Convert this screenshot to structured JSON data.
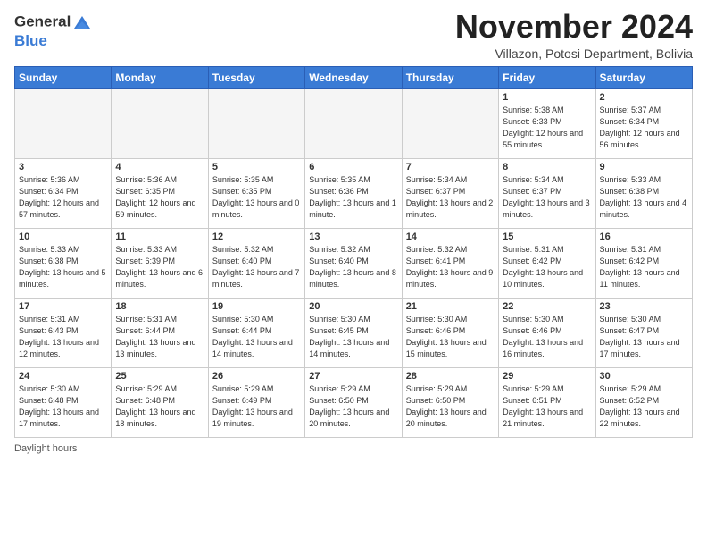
{
  "header": {
    "logo_line1": "General",
    "logo_line2": "Blue",
    "month_title": "November 2024",
    "subtitle": "Villazon, Potosi Department, Bolivia"
  },
  "days_of_week": [
    "Sunday",
    "Monday",
    "Tuesday",
    "Wednesday",
    "Thursday",
    "Friday",
    "Saturday"
  ],
  "weeks": [
    [
      {
        "day": "",
        "info": ""
      },
      {
        "day": "",
        "info": ""
      },
      {
        "day": "",
        "info": ""
      },
      {
        "day": "",
        "info": ""
      },
      {
        "day": "",
        "info": ""
      },
      {
        "day": "1",
        "info": "Sunrise: 5:38 AM\nSunset: 6:33 PM\nDaylight: 12 hours and 55 minutes."
      },
      {
        "day": "2",
        "info": "Sunrise: 5:37 AM\nSunset: 6:34 PM\nDaylight: 12 hours and 56 minutes."
      }
    ],
    [
      {
        "day": "3",
        "info": "Sunrise: 5:36 AM\nSunset: 6:34 PM\nDaylight: 12 hours and 57 minutes."
      },
      {
        "day": "4",
        "info": "Sunrise: 5:36 AM\nSunset: 6:35 PM\nDaylight: 12 hours and 59 minutes."
      },
      {
        "day": "5",
        "info": "Sunrise: 5:35 AM\nSunset: 6:35 PM\nDaylight: 13 hours and 0 minutes."
      },
      {
        "day": "6",
        "info": "Sunrise: 5:35 AM\nSunset: 6:36 PM\nDaylight: 13 hours and 1 minute."
      },
      {
        "day": "7",
        "info": "Sunrise: 5:34 AM\nSunset: 6:37 PM\nDaylight: 13 hours and 2 minutes."
      },
      {
        "day": "8",
        "info": "Sunrise: 5:34 AM\nSunset: 6:37 PM\nDaylight: 13 hours and 3 minutes."
      },
      {
        "day": "9",
        "info": "Sunrise: 5:33 AM\nSunset: 6:38 PM\nDaylight: 13 hours and 4 minutes."
      }
    ],
    [
      {
        "day": "10",
        "info": "Sunrise: 5:33 AM\nSunset: 6:38 PM\nDaylight: 13 hours and 5 minutes."
      },
      {
        "day": "11",
        "info": "Sunrise: 5:33 AM\nSunset: 6:39 PM\nDaylight: 13 hours and 6 minutes."
      },
      {
        "day": "12",
        "info": "Sunrise: 5:32 AM\nSunset: 6:40 PM\nDaylight: 13 hours and 7 minutes."
      },
      {
        "day": "13",
        "info": "Sunrise: 5:32 AM\nSunset: 6:40 PM\nDaylight: 13 hours and 8 minutes."
      },
      {
        "day": "14",
        "info": "Sunrise: 5:32 AM\nSunset: 6:41 PM\nDaylight: 13 hours and 9 minutes."
      },
      {
        "day": "15",
        "info": "Sunrise: 5:31 AM\nSunset: 6:42 PM\nDaylight: 13 hours and 10 minutes."
      },
      {
        "day": "16",
        "info": "Sunrise: 5:31 AM\nSunset: 6:42 PM\nDaylight: 13 hours and 11 minutes."
      }
    ],
    [
      {
        "day": "17",
        "info": "Sunrise: 5:31 AM\nSunset: 6:43 PM\nDaylight: 13 hours and 12 minutes."
      },
      {
        "day": "18",
        "info": "Sunrise: 5:31 AM\nSunset: 6:44 PM\nDaylight: 13 hours and 13 minutes."
      },
      {
        "day": "19",
        "info": "Sunrise: 5:30 AM\nSunset: 6:44 PM\nDaylight: 13 hours and 14 minutes."
      },
      {
        "day": "20",
        "info": "Sunrise: 5:30 AM\nSunset: 6:45 PM\nDaylight: 13 hours and 14 minutes."
      },
      {
        "day": "21",
        "info": "Sunrise: 5:30 AM\nSunset: 6:46 PM\nDaylight: 13 hours and 15 minutes."
      },
      {
        "day": "22",
        "info": "Sunrise: 5:30 AM\nSunset: 6:46 PM\nDaylight: 13 hours and 16 minutes."
      },
      {
        "day": "23",
        "info": "Sunrise: 5:30 AM\nSunset: 6:47 PM\nDaylight: 13 hours and 17 minutes."
      }
    ],
    [
      {
        "day": "24",
        "info": "Sunrise: 5:30 AM\nSunset: 6:48 PM\nDaylight: 13 hours and 17 minutes."
      },
      {
        "day": "25",
        "info": "Sunrise: 5:29 AM\nSunset: 6:48 PM\nDaylight: 13 hours and 18 minutes."
      },
      {
        "day": "26",
        "info": "Sunrise: 5:29 AM\nSunset: 6:49 PM\nDaylight: 13 hours and 19 minutes."
      },
      {
        "day": "27",
        "info": "Sunrise: 5:29 AM\nSunset: 6:50 PM\nDaylight: 13 hours and 20 minutes."
      },
      {
        "day": "28",
        "info": "Sunrise: 5:29 AM\nSunset: 6:50 PM\nDaylight: 13 hours and 20 minutes."
      },
      {
        "day": "29",
        "info": "Sunrise: 5:29 AM\nSunset: 6:51 PM\nDaylight: 13 hours and 21 minutes."
      },
      {
        "day": "30",
        "info": "Sunrise: 5:29 AM\nSunset: 6:52 PM\nDaylight: 13 hours and 22 minutes."
      }
    ]
  ],
  "footer": {
    "daylight_label": "Daylight hours"
  }
}
